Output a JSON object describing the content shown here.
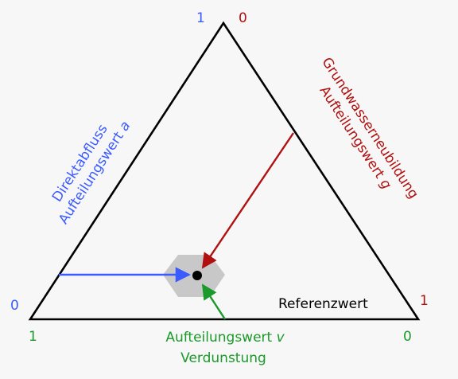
{
  "colors": {
    "blue": "#3b5bff",
    "red": "#b01010",
    "green": "#1a9a2a",
    "black": "#000000",
    "hex_fill": "#c8c8c8",
    "background": "#f7f7f7"
  },
  "ticks": {
    "top_blue": "1",
    "top_red": "0",
    "left_blue": "0",
    "right_red": "1",
    "bottom_left_green": "1",
    "bottom_right_green": "0"
  },
  "labels": {
    "left_line1": "Direktabfluss",
    "left_line2": "Aufteilungswert ",
    "left_var": "a",
    "right_line1": "Grundwasserneubildung",
    "right_line2": "Aufteilungswert ",
    "right_var": "g",
    "bottom_line1": "Aufteilungswert ",
    "bottom_var": "v",
    "bottom_line2": "Verdunstung",
    "reference": "Referenzwert"
  }
}
